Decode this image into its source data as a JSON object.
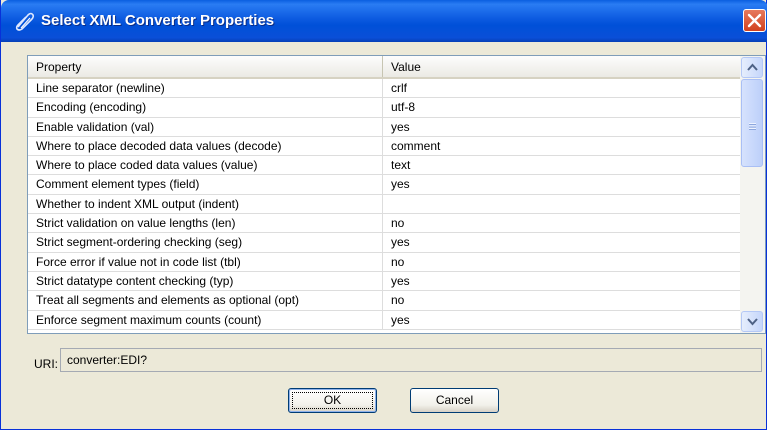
{
  "window": {
    "title": "Select XML Converter Properties",
    "icon": "paperclip-icon",
    "close_icon": "close-icon"
  },
  "grid": {
    "columns": [
      "Property",
      "Value"
    ],
    "rows": [
      {
        "property": "Line separator (newline)",
        "value": "crlf"
      },
      {
        "property": "Encoding (encoding)",
        "value": "utf-8"
      },
      {
        "property": "Enable validation (val)",
        "value": "yes"
      },
      {
        "property": "Where to place decoded data values (decode)",
        "value": "comment"
      },
      {
        "property": "Where to place coded data values (value)",
        "value": "text"
      },
      {
        "property": "Comment element types (field)",
        "value": "yes"
      },
      {
        "property": "Whether to indent XML output (indent)",
        "value": ""
      },
      {
        "property": "Strict validation on value lengths (len)",
        "value": "no"
      },
      {
        "property": "Strict segment-ordering checking (seg)",
        "value": "yes"
      },
      {
        "property": "Force error if value not in code list (tbl)",
        "value": "no"
      },
      {
        "property": "Strict datatype content checking (typ)",
        "value": "yes"
      },
      {
        "property": "Treat all segments and elements as optional (opt)",
        "value": "no"
      },
      {
        "property": "Enforce segment maximum counts (count)",
        "value": "yes"
      }
    ]
  },
  "uri": {
    "label": "URI:",
    "value": "converter:EDI?"
  },
  "buttons": {
    "ok": "OK",
    "cancel": "Cancel"
  },
  "colors": {
    "titlebar": "#0a4fd8",
    "window_bg": "#ece9d8",
    "close_button": "#d2411f"
  }
}
